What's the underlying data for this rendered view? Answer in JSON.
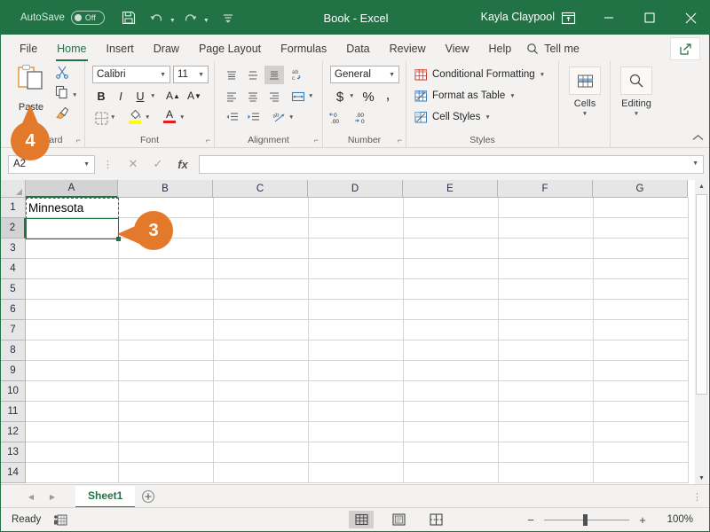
{
  "titlebar": {
    "autosave_label": "AutoSave",
    "autosave_state": "Off",
    "save_icon": "save-icon",
    "undo_icon": "undo-icon",
    "redo_icon": "redo-icon",
    "customize_icon": "customize-quick-access-icon",
    "title": "Book  -  Excel",
    "user": "Kayla Claypool",
    "ribbon_display_icon": "ribbon-display-options-icon",
    "minimize_icon": "minimize-icon",
    "maximize_icon": "maximize-icon",
    "close_icon": "close-icon"
  },
  "tabs": [
    {
      "label": "File",
      "active": false
    },
    {
      "label": "Home",
      "active": true
    },
    {
      "label": "Insert",
      "active": false
    },
    {
      "label": "Draw",
      "active": false
    },
    {
      "label": "Page Layout",
      "active": false
    },
    {
      "label": "Formulas",
      "active": false
    },
    {
      "label": "Data",
      "active": false
    },
    {
      "label": "Review",
      "active": false
    },
    {
      "label": "View",
      "active": false
    },
    {
      "label": "Help",
      "active": false
    }
  ],
  "tellme": {
    "label": "Tell me",
    "icon": "search-icon"
  },
  "share": {
    "icon": "share-icon",
    "label": "Share"
  },
  "ribbon": {
    "clipboard": {
      "group_label": "Clipboard",
      "paste_label": "Paste",
      "cut_label": "Cut",
      "copy_label": "Copy",
      "format_painter_label": "Format Painter"
    },
    "font": {
      "group_label": "Font",
      "font_name": "Calibri",
      "font_size": "11",
      "bold": "B",
      "italic": "I",
      "underline": "U",
      "grow_font": "A",
      "shrink_font": "A",
      "borders_label": "Borders",
      "fill_color_label": "Fill Color",
      "fill_color": "#ffff00",
      "font_color_label": "Font Color",
      "font_color": "#e02020"
    },
    "alignment": {
      "group_label": "Alignment",
      "top_align": "Top Align",
      "middle_align": "Middle Align",
      "bottom_align": "Bottom Align",
      "wrap_text": "Wrap Text",
      "align_left": "Align Left",
      "center": "Center",
      "align_right": "Align Right",
      "merge_center": "Merge & Center",
      "decrease_indent": "Decrease Indent",
      "increase_indent": "Increase Indent",
      "orientation": "Orientation"
    },
    "number": {
      "group_label": "Number",
      "format": "General",
      "accounting": "$",
      "percent": "%",
      "comma": ",",
      "increase_decimal": "Increase Decimal",
      "decrease_decimal": "Decrease Decimal"
    },
    "styles": {
      "group_label": "Styles",
      "items": [
        {
          "label": "Conditional Formatting",
          "icon": "conditional-formatting-icon"
        },
        {
          "label": "Format as Table",
          "icon": "format-as-table-icon"
        },
        {
          "label": "Cell Styles",
          "icon": "cell-styles-icon"
        }
      ]
    },
    "cells": {
      "label": "Cells",
      "icon": "cells-icon"
    },
    "editing": {
      "label": "Editing",
      "icon": "editing-search-icon"
    },
    "collapse_icon": "collapse-ribbon-icon"
  },
  "formulabar": {
    "namebox": "A2",
    "cancel_icon": "cancel-icon",
    "enter_icon": "enter-icon",
    "function_icon": "fx",
    "value": "",
    "placeholder": ""
  },
  "grid": {
    "columns": [
      "A",
      "B",
      "C",
      "D",
      "E",
      "F",
      "G"
    ],
    "rows": [
      1,
      2,
      3,
      4,
      5,
      6,
      7,
      8,
      9,
      10,
      11,
      12,
      13,
      14
    ],
    "active_cell": "A2",
    "active_column": "A",
    "active_row": 2,
    "copied_range": "A1",
    "cells": [
      {
        "ref": "A1",
        "col": 0,
        "row": 1,
        "value": "Minnesota"
      }
    ]
  },
  "sheetbar": {
    "prev_icon": "previous-sheet-icon",
    "next_icon": "next-sheet-icon",
    "sheets": [
      {
        "name": "Sheet1",
        "active": true
      }
    ],
    "add_sheet_icon": "add-sheet-icon"
  },
  "statusbar": {
    "status": "Ready",
    "accessibility_icon": "accessibility-checker-icon",
    "views": [
      {
        "name": "normal-view",
        "selected": true
      },
      {
        "name": "page-layout-view",
        "selected": false
      },
      {
        "name": "page-break-preview",
        "selected": false
      }
    ],
    "zoom_out": "−",
    "zoom_in": "+",
    "zoom_level": "100%"
  },
  "callouts": [
    {
      "number": "3",
      "target": "active-cell-a2",
      "direction": "left"
    },
    {
      "number": "4",
      "target": "paste-button",
      "direction": "up"
    }
  ],
  "colors": {
    "excel_green": "#217346",
    "callout_orange": "#e3792a",
    "ribbon_bg": "#f3f2f1"
  }
}
